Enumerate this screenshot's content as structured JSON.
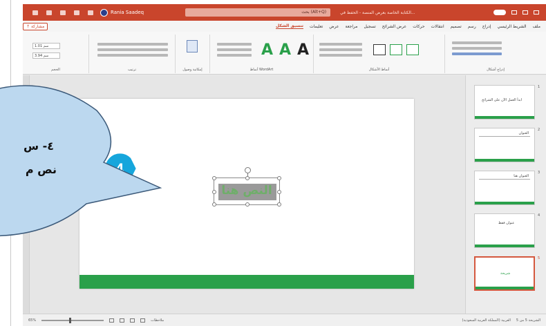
{
  "titlebar": {
    "username": "Rania Saadeq",
    "search_text": "بحث (Alt+Q)",
    "doc_title": "الكتابة الخاصة بعرض المنصة - الحفظ في...",
    "accent": "#c9452c"
  },
  "tabs": [
    "ملف",
    "الشريط الرئيسي",
    "إدراج",
    "رسم",
    "تصميم",
    "انتقالات",
    "حركات",
    "عرض الشرائح",
    "تسجيل",
    "مراجعة",
    "عرض",
    "تعليمات",
    "تنسيق الشكل"
  ],
  "tabs_active_index": 12,
  "share_label": "↑ مشاركة",
  "ribbon": {
    "groups": [
      "إدراج أشكال",
      "أنماط الأشكال",
      "أنماط WordArt",
      "إمكانية وصول",
      "ترتيب",
      "الحجم"
    ],
    "wordart_glyph": "A",
    "size_height": "1.01 سم",
    "size_width": "3.94 سم"
  },
  "slide": {
    "textbox_text": "النص هنا",
    "accent_green": "#2aa04a"
  },
  "step_marker": {
    "number": "4",
    "color": "#16a6dc"
  },
  "callout": {
    "line1": "٤- س",
    "line2": "نص م",
    "fill": "#bcd8ef",
    "stroke": "#3c5a7a"
  },
  "thumbnails": [
    {
      "num": "1",
      "text": "ابدأ العمل الآن على الشرائح"
    },
    {
      "num": "2",
      "text": "العنوان"
    },
    {
      "num": "3",
      "text": "العنوان هنا"
    },
    {
      "num": "4",
      "text": "عنوان فقط"
    },
    {
      "num": "5",
      "text": "شريحة"
    }
  ],
  "statusbar": {
    "slide_info": "الشريحة 5 من 5",
    "language": "العربية (المملكة العربية السعودية)",
    "notes": "ملاحظات",
    "zoom": "65%"
  }
}
